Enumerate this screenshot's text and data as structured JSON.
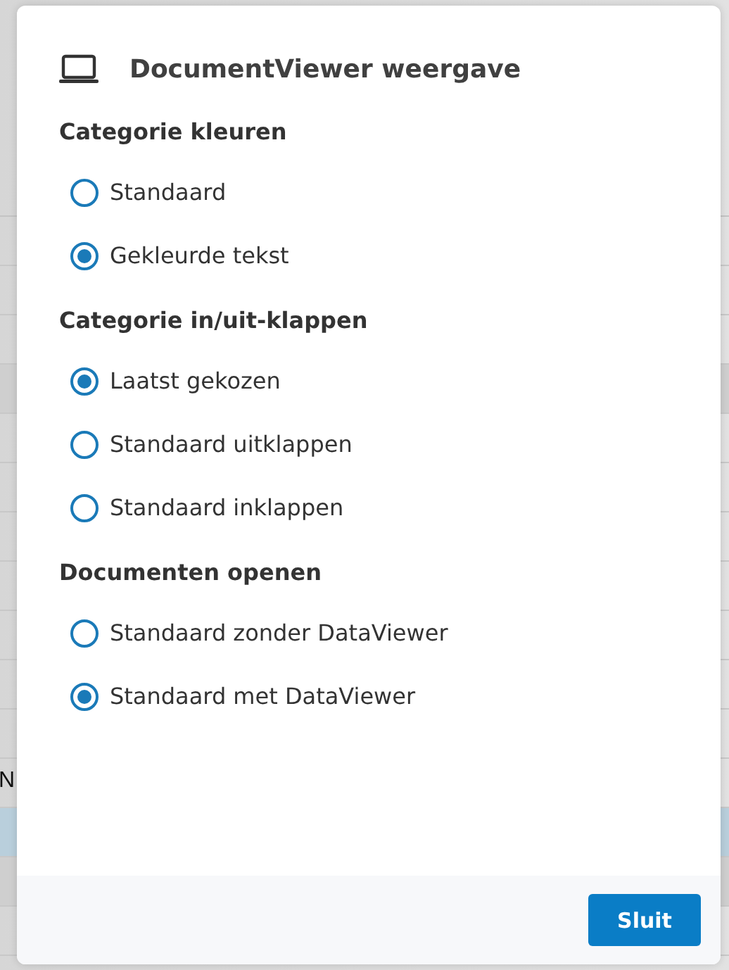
{
  "background": {
    "fragment": "N"
  },
  "dialog": {
    "title": "DocumentViewer weergave",
    "sections": [
      {
        "heading": "Categorie kleuren",
        "options": [
          {
            "label": "Standaard",
            "selected": false
          },
          {
            "label": "Gekleurde tekst",
            "selected": true
          }
        ]
      },
      {
        "heading": "Categorie in/uit-klappen",
        "options": [
          {
            "label": "Laatst gekozen",
            "selected": true
          },
          {
            "label": "Standaard uitklappen",
            "selected": false
          },
          {
            "label": "Standaard inklappen",
            "selected": false
          }
        ]
      },
      {
        "heading": "Documenten openen",
        "options": [
          {
            "label": "Standaard zonder DataViewer",
            "selected": false
          },
          {
            "label": "Standaard met DataViewer",
            "selected": true
          }
        ]
      }
    ],
    "buttons": [
      "Sluit"
    ]
  }
}
